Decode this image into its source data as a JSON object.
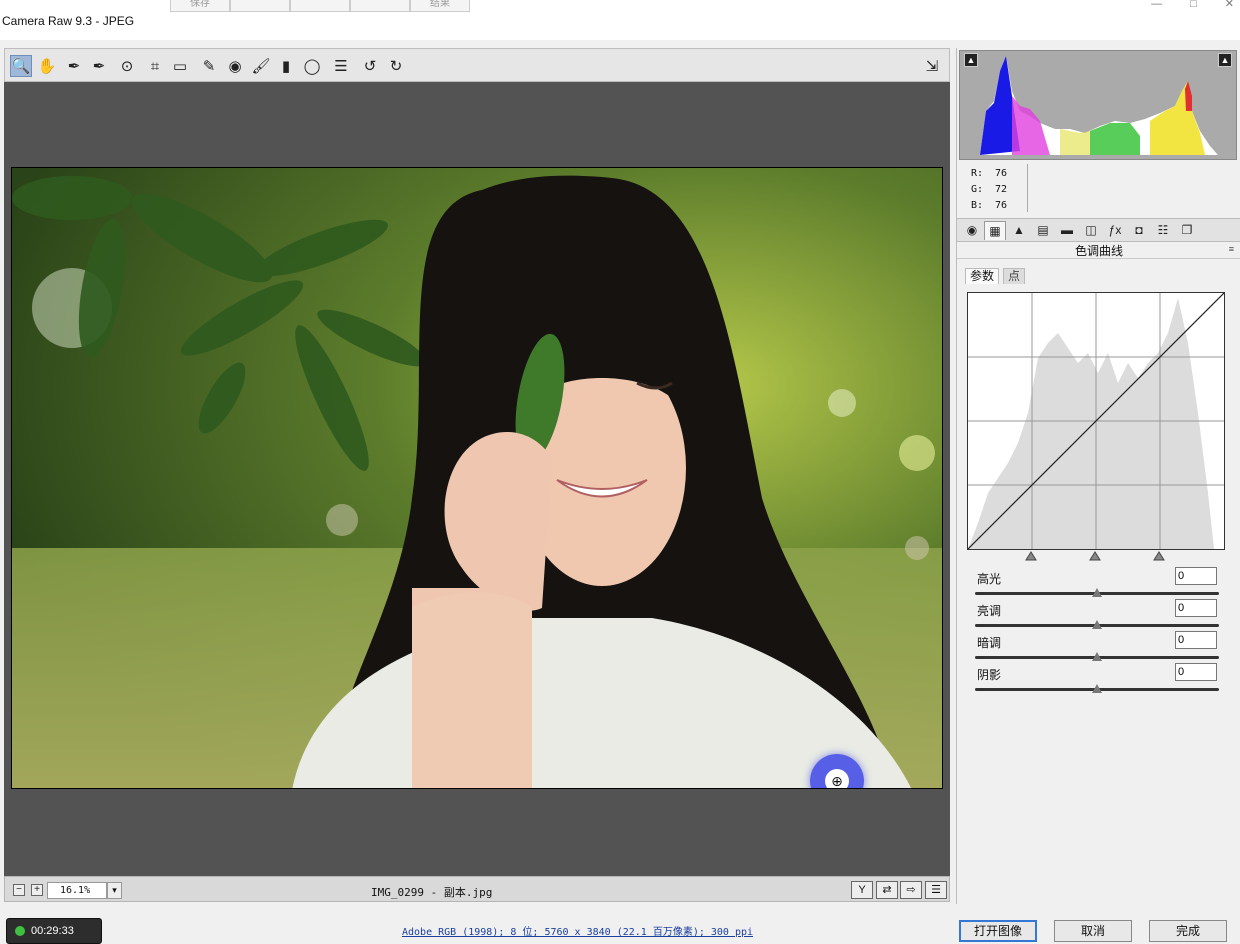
{
  "window": {
    "title": "Camera Raw 9.3 -  JPEG",
    "ghost_tabs": [
      "保存",
      "",
      "",
      "",
      "结果"
    ],
    "controls": [
      "—",
      "□",
      "✕"
    ]
  },
  "toolbar": {
    "tools": [
      {
        "name": "zoom-tool",
        "glyph": "🔍",
        "active": true
      },
      {
        "name": "hand-tool",
        "glyph": "✋"
      },
      {
        "name": "white-balance-tool",
        "glyph": "✒"
      },
      {
        "name": "color-sampler-tool",
        "glyph": "✒"
      },
      {
        "name": "targeted-adjustment-tool",
        "glyph": "⊙"
      },
      {
        "name": "crop-tool",
        "glyph": "⌗"
      },
      {
        "name": "straighten-tool",
        "glyph": "▭"
      },
      {
        "name": "spot-removal-tool",
        "glyph": "✎"
      },
      {
        "name": "red-eye-tool",
        "glyph": "◉"
      },
      {
        "name": "adjustment-brush-tool",
        "glyph": "🖌"
      },
      {
        "name": "graduated-filter-tool",
        "glyph": "▮"
      },
      {
        "name": "radial-filter-tool",
        "glyph": "◯"
      },
      {
        "name": "preferences-tool",
        "glyph": "☰"
      },
      {
        "name": "rotate-left-tool",
        "glyph": "↺"
      },
      {
        "name": "rotate-right-tool",
        "glyph": "↻"
      }
    ],
    "fullscreen_glyph": "⇲"
  },
  "status": {
    "zoom": "16.1%",
    "filename": "IMG_0299 - 副本.jpg"
  },
  "histogram": {
    "r": "76",
    "g": "72",
    "b": "76"
  },
  "panel": {
    "section_title": "色调曲线",
    "subtabs": [
      "参数",
      "点"
    ],
    "sliders": [
      {
        "label": "高光",
        "value": "0",
        "position": 0.5
      },
      {
        "label": "亮调",
        "value": "0",
        "position": 0.5
      },
      {
        "label": "暗调",
        "value": "0",
        "position": 0.5
      },
      {
        "label": "阴影",
        "value": "0",
        "position": 0.5
      }
    ]
  },
  "bottom": {
    "timer": "00:29:33",
    "info": "Adobe RGB (1998); 8 位; 5760 x 3840 (22.1 百万像素); 300 ppi",
    "open_button": "打开图像",
    "cancel_button": "取消",
    "done_button": "完成"
  },
  "colors": {
    "canvas_bg": "#535353",
    "accent": "#3478d4",
    "zoom_cursor": "#3c46e6"
  }
}
